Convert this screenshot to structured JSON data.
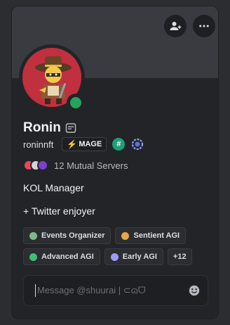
{
  "profile": {
    "display_name": "Ronin",
    "username": "roninnft",
    "clan_tag": "MAGE",
    "custom_role": "KOL Manager",
    "bio": "+ Twitter enjoyer",
    "mutual_servers": "12 Mutual Servers",
    "status": "online"
  },
  "roles": [
    {
      "label": "Events Organizer",
      "color": "#7fb98a"
    },
    {
      "label": "Sentient AGI",
      "color": "#e9a54b"
    },
    {
      "label": "Advanced AGI",
      "color": "#3fbf73"
    },
    {
      "label": "Early AGI",
      "color": "#9a9cf5"
    }
  ],
  "roles_more": "+12",
  "message": {
    "placeholder": "Message @shuurai | ⊂ɷᗜ"
  },
  "colors": {
    "card_bg": "#232428",
    "banner": "#3a3b41",
    "status_online": "#23a55a",
    "avatar_bg": "#c0303f"
  },
  "icons": {
    "add_friend": "add-friend-icon",
    "more": "more-icon",
    "note": "note-icon",
    "emoji": "emoji-icon"
  }
}
